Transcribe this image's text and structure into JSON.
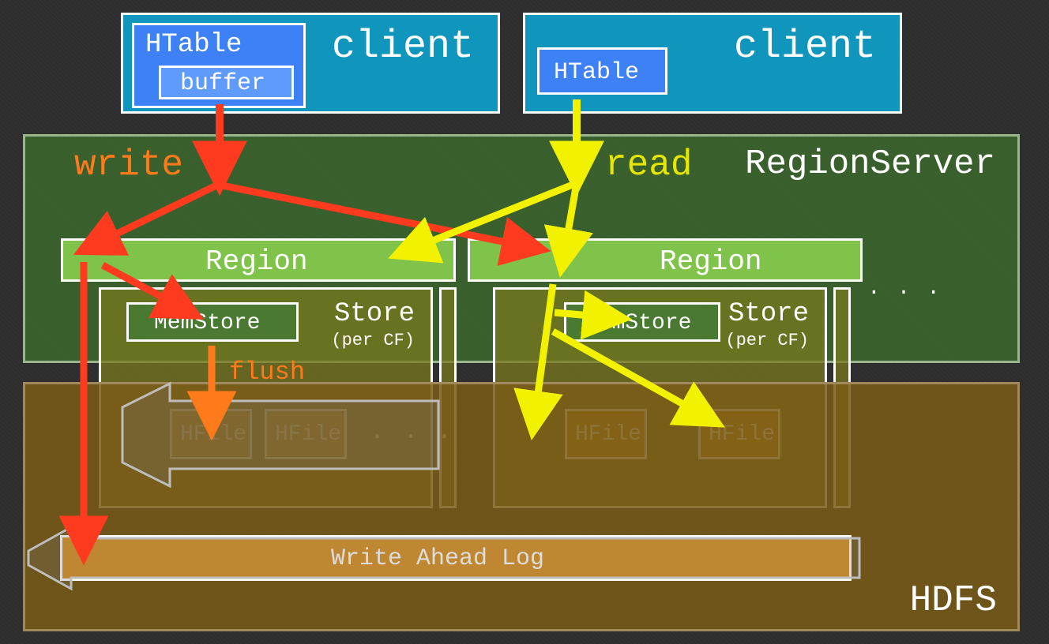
{
  "clients": {
    "left": {
      "title": "client",
      "htable": "HTable",
      "buffer": "buffer"
    },
    "right": {
      "title": "client",
      "htable": "HTable"
    }
  },
  "regionServer": {
    "title": "RegionServer"
  },
  "labels": {
    "write": "write",
    "read": "read",
    "flush": "flush"
  },
  "regions": {
    "left": {
      "title": "Region",
      "store": "Store",
      "percf": "(per CF)",
      "memstore": "MemStore",
      "hfile1": "HFile",
      "hfile2": "HFile",
      "dots": ". . ."
    },
    "right": {
      "title": "Region",
      "store": "Store",
      "percf": "(per CF)",
      "memstore": "MemStore",
      "hfile1": "HFile",
      "hfile2": "HFile"
    },
    "dots": ". . ."
  },
  "hdfs": {
    "title": "HDFS",
    "wal": "Write Ahead Log"
  }
}
